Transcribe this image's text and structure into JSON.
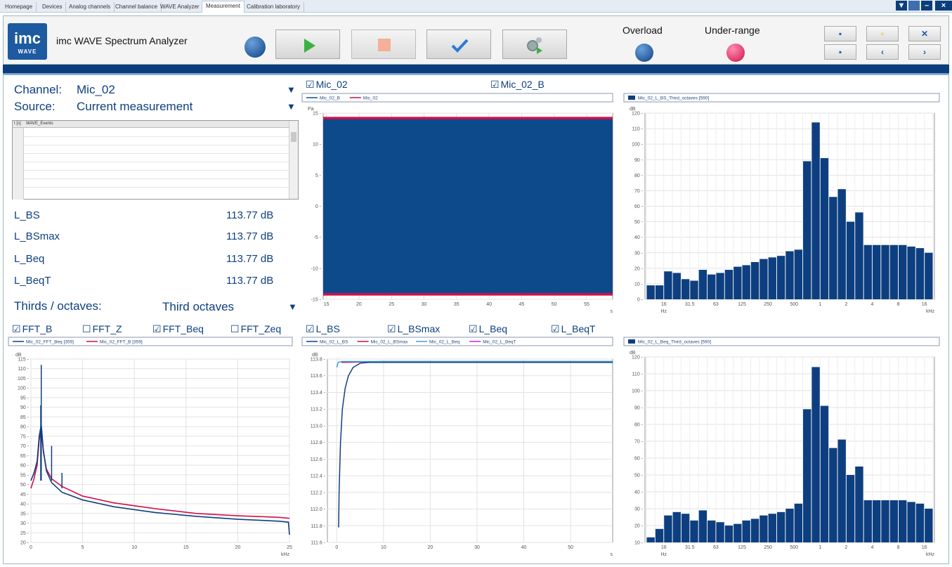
{
  "tabs": [
    "Homepage",
    "Devices",
    "Analog channels",
    "Channel balance",
    "WAVE Analyzer",
    "Measurement",
    "Calibration laboratory"
  ],
  "active_tab": "Measurement",
  "window_controls": [
    "▼",
    "–",
    "×"
  ],
  "logo": {
    "top": "imc",
    "bottom": "WAVE"
  },
  "app_title": "imc WAVE Spectrum Analyzer",
  "status": {
    "overload_label": "Overload",
    "underrange_label": "Under-range",
    "overload_color": "#1e5aa8",
    "underrange_color": "#e0245e"
  },
  "toolbar": {
    "play": "play-icon",
    "stop": "stop-icon",
    "check": "check-icon",
    "settings": "gears-icon"
  },
  "left_panel": {
    "channel_label": "Channel:",
    "channel_value": "Mic_02",
    "source_label": "Source:",
    "source_value": "Current measurement",
    "events_table": {
      "col1": "t [s]",
      "col2": "WAVE_Events"
    },
    "measurements": [
      {
        "name": "L_BS",
        "value": "113.77 dB"
      },
      {
        "name": "L_BSmax",
        "value": "113.77 dB"
      },
      {
        "name": "L_Beq",
        "value": "113.77 dB"
      },
      {
        "name": "L_BeqT",
        "value": "113.77 dB"
      }
    ],
    "thirds_label": "Thirds / octaves:",
    "thirds_value": "Third octaves"
  },
  "checkboxes": {
    "top": [
      {
        "label": "Mic_02",
        "checked": true
      },
      {
        "label": "Mic_02_B",
        "checked": true
      }
    ],
    "fft": [
      {
        "label": "FFT_B",
        "checked": true
      },
      {
        "label": "FFT_Z",
        "checked": false
      },
      {
        "label": "FFT_Beq",
        "checked": true
      },
      {
        "label": "FFT_Zeq",
        "checked": false
      }
    ],
    "levels": [
      {
        "label": "L_BS",
        "checked": true
      },
      {
        "label": "L_BSmax",
        "checked": true
      },
      {
        "label": "L_Beq",
        "checked": true
      },
      {
        "label": "L_BeqT",
        "checked": true
      }
    ]
  },
  "chart_data": [
    {
      "id": "time-signal",
      "type": "area",
      "ylabel": "Pa",
      "xlabel": "s",
      "legend": [
        "Mic_02_B",
        "Mic_02"
      ],
      "colors": [
        "#0d4a8c",
        "#d0104c"
      ],
      "xlim": [
        14.5,
        59
      ],
      "ylim": [
        -15,
        15
      ],
      "xticks": [
        15,
        20,
        25,
        30,
        35,
        40,
        45,
        50,
        55
      ],
      "yticks": [
        15,
        10,
        5,
        0,
        -5,
        -10,
        -15
      ],
      "envelope": {
        "Mic_02_B": [
          -14,
          14
        ],
        "Mic_02": [
          -14.4,
          14.4
        ]
      }
    },
    {
      "id": "bs-third-octaves",
      "type": "bar",
      "ylabel": "dB",
      "xlabel": "Hz",
      "xlabel_right": "kHz",
      "legend": [
        "Mic_02_L_BS_Third_octaves [590]"
      ],
      "ylim": [
        0,
        120
      ],
      "yticks": [
        120,
        110,
        100,
        90,
        80,
        70,
        60,
        50,
        40,
        30,
        20,
        10,
        0
      ],
      "xtick_labels": [
        "16",
        "31.5",
        "63",
        "125",
        "250",
        "500",
        "1",
        "2",
        "4",
        "8",
        "16"
      ],
      "xtick_bands": [
        2,
        5,
        8,
        11,
        14,
        17,
        20,
        23,
        26,
        29,
        32
      ],
      "values": [
        9,
        9,
        18,
        17,
        13,
        12,
        19,
        16,
        17,
        19,
        21,
        22,
        24,
        26,
        27,
        28,
        31,
        32,
        89,
        114,
        91,
        66,
        71,
        50,
        56,
        35,
        35,
        35,
        35,
        35,
        34,
        33,
        30
      ]
    },
    {
      "id": "fft",
      "type": "line",
      "ylabel": "dB",
      "xlabel": "kHz",
      "legend": [
        "Mic_02_FFT_Beq [359]",
        "Mic_02_FFT_B [359]"
      ],
      "colors": [
        "#0d3f80",
        "#d0104c"
      ],
      "xlim": [
        0,
        25
      ],
      "ylim": [
        20,
        115
      ],
      "xticks": [
        0,
        5,
        10,
        15,
        20,
        25
      ],
      "yticks": [
        115,
        110,
        105,
        100,
        95,
        90,
        85,
        80,
        75,
        70,
        65,
        60,
        55,
        50,
        45,
        40,
        35,
        30,
        25,
        20
      ],
      "series": [
        {
          "name": "Mic_02_FFT_Beq [359]",
          "x": [
            0,
            0.3,
            0.6,
            0.8,
            1.0,
            1.2,
            1.5,
            2,
            3,
            5,
            8,
            12,
            16,
            20,
            24,
            24.9,
            25
          ],
          "y": [
            52,
            56,
            62,
            75,
            81,
            68,
            57,
            51,
            46,
            42,
            38.5,
            35.5,
            33.5,
            32,
            31,
            30.5,
            24
          ]
        },
        {
          "name": "Mic_02_FFT_B [359]",
          "x": [
            0,
            0.3,
            0.6,
            0.8,
            1.0,
            1.2,
            1.5,
            2,
            3,
            5,
            8,
            12,
            16,
            20,
            24,
            25
          ],
          "y": [
            48,
            53,
            60,
            73,
            79,
            67,
            58,
            53,
            49,
            44,
            40.5,
            37.5,
            35,
            33.8,
            33,
            32.5
          ]
        }
      ],
      "spikes": [
        {
          "x": 1.0,
          "y": 112
        },
        {
          "x": 0.95,
          "y": 91
        },
        {
          "x": 2.0,
          "y": 70
        },
        {
          "x": 3.0,
          "y": 56
        }
      ]
    },
    {
      "id": "levels",
      "type": "line",
      "ylabel": "dB",
      "xlabel": "s",
      "legend": [
        "Mic_02_L_BS",
        "Mic_02_L_BSmax",
        "Mic_02_L_Beq",
        "Mic_02_L_BeqT"
      ],
      "colors": [
        "#0d3f80",
        "#c0104c",
        "#3aa0e0",
        "#d020d0"
      ],
      "xlim": [
        -2,
        59
      ],
      "ylim": [
        111.6,
        113.8
      ],
      "xticks": [
        0,
        10,
        20,
        30,
        40,
        50
      ],
      "yticks": [
        113.8,
        113.6,
        113.4,
        113.2,
        113.0,
        112.8,
        112.6,
        112.4,
        112.2,
        112.0,
        111.8,
        111.6
      ],
      "series": [
        {
          "name": "Mic_02_L_BS",
          "x": [
            0.4,
            0.5,
            0.8,
            1.2,
            1.8,
            2.5,
            3.5,
            5,
            7,
            10,
            59
          ],
          "y": [
            111.78,
            112.2,
            112.8,
            113.2,
            113.45,
            113.6,
            113.7,
            113.75,
            113.76,
            113.76,
            113.76
          ]
        },
        {
          "name": "Mic_02_L_BSmax",
          "x": [
            1,
            10,
            30,
            59
          ],
          "y": [
            113.76,
            113.77,
            113.77,
            113.77
          ]
        },
        {
          "name": "Mic_02_L_Beq",
          "x": [
            0,
            0.3,
            1,
            3,
            59
          ],
          "y": [
            113.7,
            113.76,
            113.77,
            113.77,
            113.77
          ]
        },
        {
          "name": "Mic_02_L_BeqT",
          "x": [
            5,
            59
          ],
          "y": [
            113.765,
            113.765
          ]
        }
      ]
    },
    {
      "id": "beq-third-octaves",
      "type": "bar",
      "ylabel": "dB",
      "xlabel": "Hz",
      "xlabel_right": "kHz",
      "legend": [
        "Mic_02_L_Beq_Third_octaves [590]"
      ],
      "ylim": [
        10,
        120
      ],
      "yticks": [
        120,
        110,
        100,
        90,
        80,
        70,
        60,
        50,
        40,
        30,
        20,
        10
      ],
      "xtick_labels": [
        "16",
        "31.5",
        "63",
        "125",
        "250",
        "500",
        "1",
        "2",
        "4",
        "8",
        "16"
      ],
      "xtick_bands": [
        2,
        5,
        8,
        11,
        14,
        17,
        20,
        23,
        26,
        29,
        32
      ],
      "values": [
        13,
        18,
        26,
        28,
        27,
        23,
        29,
        23,
        22,
        20,
        21,
        23,
        24,
        26,
        27,
        28,
        30,
        33,
        89,
        114,
        91,
        66,
        71,
        50,
        55,
        35,
        35,
        35,
        35,
        35,
        34,
        33,
        30
      ]
    }
  ]
}
